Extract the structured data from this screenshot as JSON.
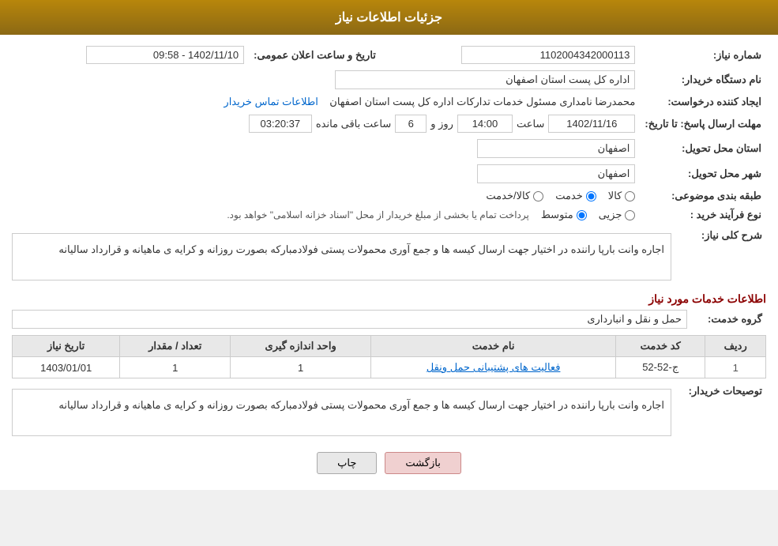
{
  "header": {
    "title": "جزئیات اطلاعات نیاز"
  },
  "fields": {
    "shomara_niaz_label": "شماره نیاز:",
    "shomara_niaz_value": "1102004342000113",
    "nam_dastgah_label": "نام دستگاه خریدار:",
    "nam_dastgah_value": "اداره کل پست استان اصفهان",
    "ejad_konande_label": "ایجاد کننده درخواست:",
    "ejad_konande_value": "محمدرضا نامداری مسئول خدمات تدارکات اداره کل پست استان اصفهان",
    "ejad_konande_link": "اطلاعات تماس خریدار",
    "mohlat_label": "مهلت ارسال پاسخ: تا تاریخ:",
    "mohlat_date": "1402/11/16",
    "mohlat_time_label": "ساعت",
    "mohlat_time": "14:00",
    "mohlat_days_label": "روز و",
    "mohlat_days": "6",
    "mohlat_remaining_label": "ساعت باقی مانده",
    "mohlat_remaining": "03:20:37",
    "tarikh_elan_label": "تاریخ و ساعت اعلان عمومی:",
    "tarikh_elan_value": "1402/11/10 - 09:58",
    "ostan_tahvil_label": "استان محل تحویل:",
    "ostan_tahvil_value": "اصفهان",
    "shahr_tahvil_label": "شهر محل تحویل:",
    "shahr_tahvil_value": "اصفهان",
    "tabaqe_label": "طبقه بندی موضوعی:",
    "tabaqe_options": [
      "کالا",
      "خدمت",
      "کالا/خدمت"
    ],
    "tabaqe_selected": "خدمت",
    "nooe_farayand_label": "نوع فرآیند خرید :",
    "nooe_farayand_options": [
      "جزیی",
      "متوسط"
    ],
    "nooe_farayand_note": "پرداخت تمام یا بخشی از مبلغ خریدار از محل \"اسناد خزانه اسلامی\" خواهد بود.",
    "sharh_label": "شرح کلی نیاز:",
    "sharh_value": "اجاره وانت بارپا راننده در اختیار جهت ارسال کیسه ها و جمع آوری محمولات پستی  فولادمبارکه بصورت روزانه و کرایه ی ماهیانه و قرارداد سالیانه",
    "services_section_title": "اطلاعات خدمات مورد نیاز",
    "grooh_khadamat_label": "گروه خدمت:",
    "grooh_khadamat_value": "حمل و نقل و انبارداری",
    "table": {
      "headers": [
        "ردیف",
        "کد خدمت",
        "نام خدمت",
        "واحد اندازه گیری",
        "تعداد / مقدار",
        "تاریخ نیاز"
      ],
      "rows": [
        {
          "radif": "1",
          "kod": "ج-52-52",
          "name": "فعالیت های پشتیبانی حمل ونقل",
          "vahed": "1",
          "tedad": "1",
          "tarikh": "1403/01/01"
        }
      ]
    },
    "tosifat_label": "توصیحات خریدار:",
    "tosifat_value": "اجاره وانت بارپا راننده در اختیار جهت ارسال کیسه ها و جمع آوری محمولات پستی  فولادمبارکه بصورت روزانه و کرایه ی ماهیانه و قرارداد سالیانه",
    "buttons": {
      "print": "چاپ",
      "back": "بازگشت"
    }
  }
}
